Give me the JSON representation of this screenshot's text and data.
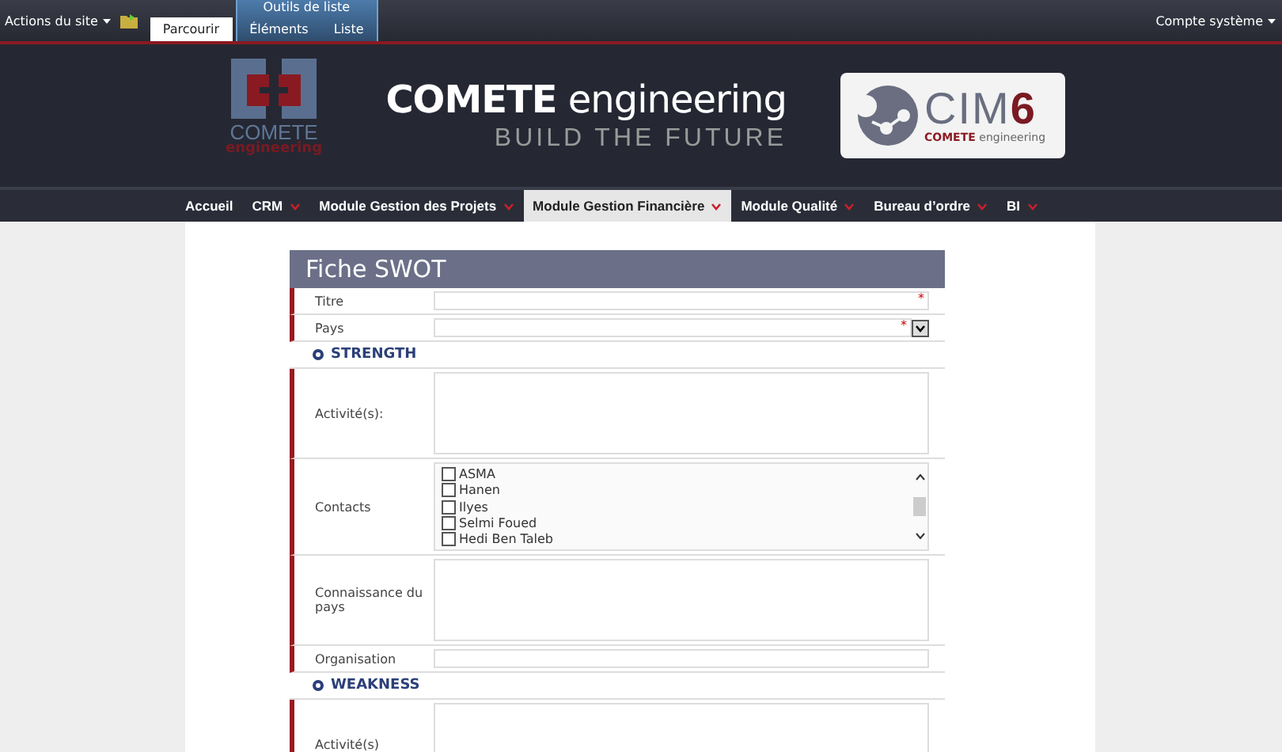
{
  "ribbon": {
    "site_actions": "Actions du site",
    "tabs": [
      {
        "label": "Parcourir",
        "selected": true
      }
    ],
    "tool_group": {
      "title": "Outils de liste",
      "tabs": [
        {
          "label": "Éléments",
          "selected": false
        },
        {
          "label": "Liste",
          "selected": false
        }
      ]
    },
    "account": "Compte système"
  },
  "banner": {
    "logo_name": "COMETE",
    "logo_sub": "engineering",
    "title_bold": "COMETE",
    "title_rest": "engineering",
    "tagline": "BUILD THE FUTURE",
    "badge_name": "CIM",
    "badge_number": "6",
    "badge_brand": "COMETE",
    "badge_sub": "engineering"
  },
  "nav": [
    {
      "label": "Accueil",
      "has_menu": false,
      "selected": false
    },
    {
      "label": "CRM",
      "has_menu": true,
      "selected": false
    },
    {
      "label": "Module Gestion des Projets",
      "has_menu": true,
      "selected": false
    },
    {
      "label": "Module Gestion Financière",
      "has_menu": true,
      "selected": true
    },
    {
      "label": "Module Qualité",
      "has_menu": true,
      "selected": false
    },
    {
      "label": "Bureau d’ordre",
      "has_menu": true,
      "selected": false
    },
    {
      "label": "BI",
      "has_menu": true,
      "selected": false
    }
  ],
  "form": {
    "title": "Fiche SWOT",
    "required_mark": "*",
    "rows": [
      {
        "kind": "text",
        "label": "Titre",
        "required": true
      },
      {
        "kind": "select",
        "label": "Pays",
        "required": true
      },
      {
        "kind": "section",
        "label": "STRENGTH"
      },
      {
        "kind": "textarea",
        "label": "Activité(s):",
        "required": false
      },
      {
        "kind": "checklist",
        "label": "Contacts",
        "options": [
          {
            "label": "ASMA",
            "checked": false
          },
          {
            "label": "Hanen",
            "checked": false
          },
          {
            "label": "Ilyes",
            "checked": false
          },
          {
            "label": "Selmi Foued",
            "checked": false
          },
          {
            "label": "Hedi Ben Taleb",
            "checked": false
          }
        ]
      },
      {
        "kind": "textarea",
        "label": "Connaissance du pays",
        "required": false
      },
      {
        "kind": "text",
        "label": "Organisation",
        "required": false
      },
      {
        "kind": "section",
        "label": "WEAKNESS"
      },
      {
        "kind": "textarea",
        "label": "Activité(s)",
        "required": false
      }
    ]
  }
}
